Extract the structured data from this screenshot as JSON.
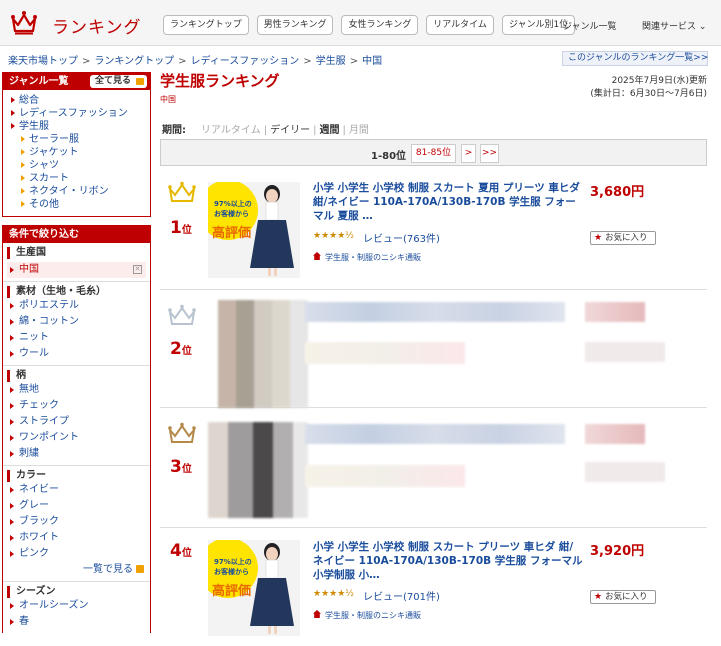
{
  "header": {
    "brand": "ランキング",
    "nav": [
      "ランキングトップ",
      "男性ランキング",
      "女性ランキング",
      "リアルタイム",
      "ジャンル別1位"
    ],
    "genre_list": "ジャンル一覧",
    "related": "関連サービス ⌄"
  },
  "breadcrumb": [
    "楽天市場トップ",
    "ランキングトップ",
    "レディースファッション",
    "学生服",
    "中国"
  ],
  "genre_ranking_link": "このジャンルのランキング一覧>>",
  "sidebar": {
    "genre_title": "ジャンル一覧",
    "show_all": "全て見る",
    "genres": [
      {
        "label": "総合",
        "level": 0
      },
      {
        "label": "レディースファッション",
        "level": 0
      },
      {
        "label": "学生服",
        "level": 0
      },
      {
        "label": "セーラー服",
        "level": 1
      },
      {
        "label": "ジャケット",
        "level": 1
      },
      {
        "label": "シャツ",
        "level": 1
      },
      {
        "label": "スカート",
        "level": 1
      },
      {
        "label": "ネクタイ・リボン",
        "level": 1
      },
      {
        "label": "その他",
        "level": 1
      }
    ],
    "filter_title": "条件で絞り込む",
    "filters": {
      "origin": {
        "title": "生産国",
        "selected": "中国"
      },
      "material": {
        "title": "素材（生地・毛糸）",
        "items": [
          "ポリエステル",
          "綿・コットン",
          "ニット",
          "ウール"
        ]
      },
      "pattern": {
        "title": "柄",
        "items": [
          "無地",
          "チェック",
          "ストライプ",
          "ワンポイント",
          "刺繍"
        ]
      },
      "color": {
        "title": "カラー",
        "items": [
          "ネイビー",
          "グレー",
          "ブラック",
          "ホワイト",
          "ピンク"
        ],
        "more": "一覧で見る"
      },
      "season": {
        "title": "シーズン",
        "items": [
          "オールシーズン",
          "春"
        ]
      }
    }
  },
  "main": {
    "title": "学生服ランキング",
    "subtitle": "中国",
    "updated": "2025年7月9日(水)更新",
    "period_range": "(集計日：6月30日〜7月6日)",
    "period_label": "期間:",
    "periods": [
      {
        "label": "リアルタイム",
        "active": false
      },
      {
        "label": "デイリー",
        "active": false
      },
      {
        "label": "週間",
        "active": true
      },
      {
        "label": "月間",
        "active": false
      }
    ],
    "pager": {
      "current": "1-80位",
      "next_range": "81-85位",
      "next": ">",
      "last": ">>"
    }
  },
  "items": [
    {
      "rank": "1",
      "unit": "位",
      "crown": "gold",
      "name": "小学 小学生 小学校 制服 スカート 夏用 プリーツ 車ヒダ 紺/ネイビー 110A-170A/130B-170B 学生服 フォーマル 夏服 …",
      "stars": "★★★★½",
      "reviews": "レビュー(763件)",
      "shop": "学生服・制服のニシキ通販",
      "price": "3,680円",
      "fav": "お気に入り",
      "badge_top": "97%以上の",
      "badge_mid": "お客様から",
      "badge_big": "高評価"
    },
    {
      "rank": "2",
      "unit": "位",
      "crown": "silver"
    },
    {
      "rank": "3",
      "unit": "位",
      "crown": "bronze"
    },
    {
      "rank": "4",
      "unit": "位",
      "crown": "none",
      "name": "小学 小学生 小学校 制服 スカート プリーツ 車ヒダ 紺/ネイビー 110A-170A/130B-170B 学生服 フォーマル 小学制服 小…",
      "stars": "★★★★½",
      "reviews": "レビュー(701件)",
      "shop": "学生服・制服のニシキ通販",
      "price": "3,920円",
      "fav": "お気に入り",
      "badge_top": "97%以上の",
      "badge_mid": "お客様から",
      "badge_big": "高評価"
    }
  ],
  "colors": {
    "accent": "#bf0000",
    "link": "#1a4c9c",
    "gold": "#e6b800",
    "silver": "#b9c3cf",
    "bronze": "#b5894a"
  }
}
